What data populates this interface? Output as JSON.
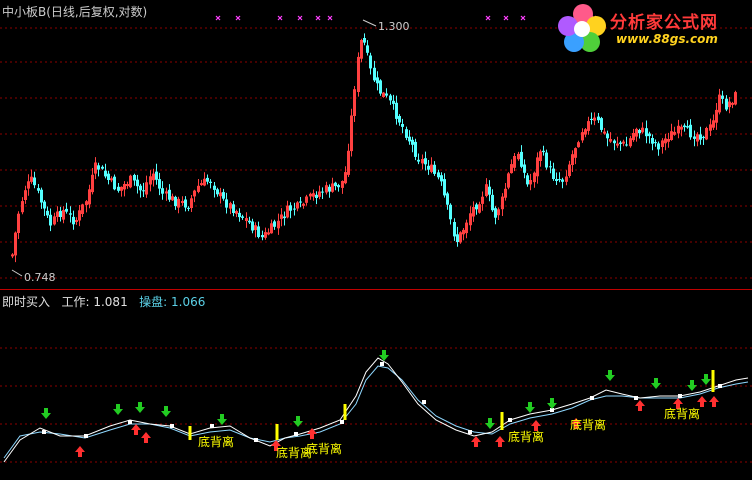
{
  "header": {
    "title": "中小板B(日线,后复权,对数)"
  },
  "watermark": {
    "title": "分析家公式网",
    "url": "www.88gs.com"
  },
  "price_panel": {
    "max_label": "1.300",
    "min_label": "0.748"
  },
  "indicator_panel": {
    "name": "即时买入",
    "work_label": "工作:",
    "work_value": "1.081",
    "trade_label": "操盘:",
    "trade_value": "1.066",
    "divergence_label": "底背离"
  },
  "colors": {
    "up": "#ff4040",
    "down": "#54ffff",
    "white_line": "#ffffff",
    "cyan_line": "#8fd8ff",
    "buy_arrow": "#ff3030",
    "sell_arrow": "#22cc22",
    "marker": "#ffff00",
    "grid": "#8b0000",
    "separator": "#c00000",
    "cross": "#ff40ff"
  },
  "icons": {
    "up_arrow": "arrow-up-icon",
    "down_arrow": "arrow-down-icon",
    "cross": "cross-icon"
  }
}
